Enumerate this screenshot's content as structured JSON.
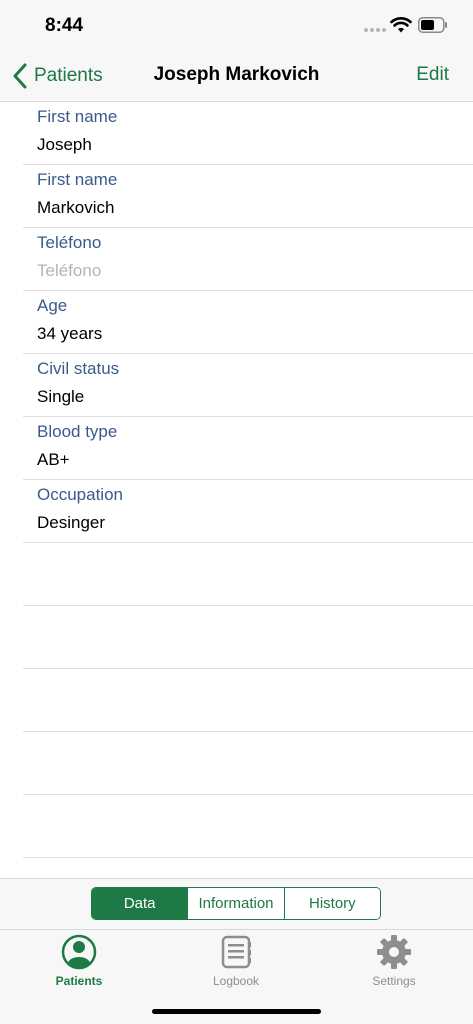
{
  "status_bar": {
    "time": "8:44"
  },
  "nav": {
    "back_label": "Patients",
    "title": "Joseph Markovich",
    "edit_label": "Edit"
  },
  "fields": [
    {
      "label": "First name",
      "value": "Joseph",
      "is_placeholder": false
    },
    {
      "label": "First name",
      "value": "Markovich",
      "is_placeholder": false
    },
    {
      "label": "Teléfono",
      "value": "Teléfono",
      "is_placeholder": true
    },
    {
      "label": "Age",
      "value": "34 years",
      "is_placeholder": false
    },
    {
      "label": "Civil status",
      "value": "Single",
      "is_placeholder": false
    },
    {
      "label": "Blood type",
      "value": "AB+",
      "is_placeholder": false
    },
    {
      "label": "Occupation",
      "value": "Desinger",
      "is_placeholder": false
    }
  ],
  "segments": {
    "selected": "Data",
    "items": [
      "Data",
      "Information",
      "History"
    ]
  },
  "tabs": {
    "selected": "Patients",
    "items": [
      {
        "label": "Patients",
        "icon": "person-icon"
      },
      {
        "label": "Logbook",
        "icon": "logbook-icon"
      },
      {
        "label": "Settings",
        "icon": "gear-icon"
      }
    ]
  },
  "colors": {
    "accent": "#1d7a46",
    "field_label": "#3a5a8c",
    "placeholder": "#b3b3b3",
    "inactive_tab": "#8e8e8e",
    "bar_background": "#f7f7f7"
  }
}
